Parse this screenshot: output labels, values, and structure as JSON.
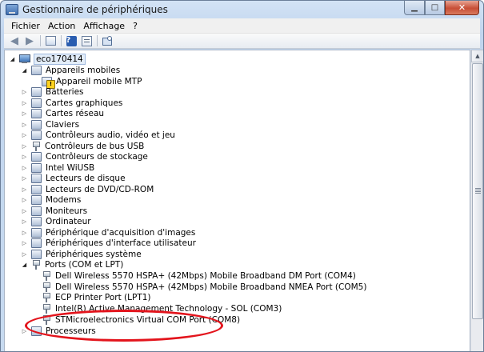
{
  "window": {
    "title": "Gestionnaire de périphériques",
    "controls": {
      "minimize": "▁",
      "maximize": "□",
      "close": "✕"
    }
  },
  "menu": {
    "items": [
      "Fichier",
      "Action",
      "Affichage",
      "?"
    ]
  },
  "tree": {
    "root": "eco170414",
    "groups": [
      {
        "label": "Appareils mobiles",
        "expanded": true,
        "children": [
          "Appareil mobile MTP"
        ]
      },
      {
        "label": "Batteries"
      },
      {
        "label": "Cartes graphiques"
      },
      {
        "label": "Cartes réseau"
      },
      {
        "label": "Claviers"
      },
      {
        "label": "Contrôleurs audio, vidéo et jeu"
      },
      {
        "label": "Contrôleurs de bus USB"
      },
      {
        "label": "Contrôleurs de stockage"
      },
      {
        "label": "Intel WiUSB"
      },
      {
        "label": "Lecteurs de disque"
      },
      {
        "label": "Lecteurs de DVD/CD-ROM"
      },
      {
        "label": "Modems"
      },
      {
        "label": "Moniteurs"
      },
      {
        "label": "Ordinateur"
      },
      {
        "label": "Périphérique d'acquisition d'images"
      },
      {
        "label": "Périphériques d'interface utilisateur"
      },
      {
        "label": "Périphériques système"
      },
      {
        "label": "Ports (COM et LPT)",
        "expanded": true,
        "children": [
          "Dell Wireless 5570 HSPA+ (42Mbps) Mobile Broadband DM Port (COM4)",
          "Dell Wireless 5570 HSPA+ (42Mbps) Mobile Broadband NMEA Port (COM5)",
          "ECP Printer Port (LPT1)",
          "Intel(R) Active Management Technology - SOL (COM3)",
          "STMicroelectronics Virtual COM Port (COM8)"
        ]
      },
      {
        "label": "Processeurs"
      }
    ]
  },
  "annotation": {
    "color": "#e3141c"
  }
}
